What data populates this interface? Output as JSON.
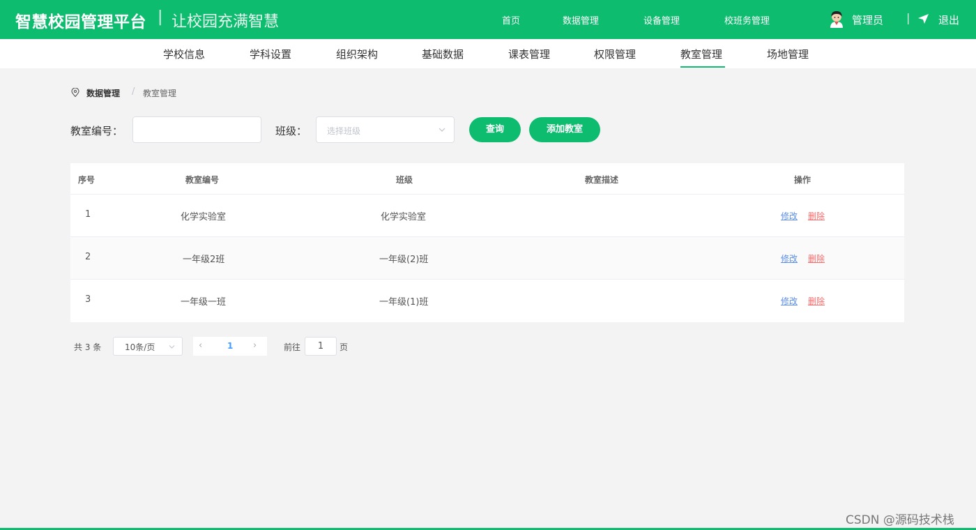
{
  "header": {
    "brand": "智慧校园管理平台",
    "separator": "|",
    "slogan": "让校园充满智慧",
    "nav": [
      "首页",
      "数据管理",
      "设备管理",
      "校班务管理"
    ],
    "user": "管理员",
    "divider": "|",
    "logout": "退出"
  },
  "subnav": {
    "items": [
      "学校信息",
      "学科设置",
      "组织架构",
      "基础数据",
      "课表管理",
      "权限管理",
      "教室管理",
      "场地管理"
    ],
    "active": "教室管理"
  },
  "breadcrumb": {
    "parent": "数据管理",
    "separator": "/",
    "current": "教室管理"
  },
  "filter": {
    "room_label": "教室编号：",
    "room_value": "",
    "class_label": "班级：",
    "class_placeholder": "选择班级",
    "query_button": "查询",
    "add_button": "添加教室"
  },
  "table": {
    "columns": [
      "序号",
      "教室编号",
      "班级",
      "教室描述",
      "操作"
    ],
    "rows": [
      {
        "index": "1",
        "room": "化学实验室",
        "class": "化学实验室",
        "desc": "",
        "edit": "修改",
        "delete": "删除"
      },
      {
        "index": "2",
        "room": "一年级2班",
        "class": "一年级(2)班",
        "desc": "",
        "edit": "修改",
        "delete": "删除"
      },
      {
        "index": "3",
        "room": "一年级一班",
        "class": "一年级(1)班",
        "desc": "",
        "edit": "修改",
        "delete": "删除"
      }
    ]
  },
  "pagination": {
    "total": "共 3 条",
    "page_size": "10条/页",
    "prev": "‹",
    "current_page": "1",
    "next": "›",
    "goto_prefix": "前往",
    "goto_value": "1",
    "goto_suffix": "页"
  },
  "watermark": "CSDN @源码技术栈",
  "colors": {
    "accent": "#0dbc6e",
    "link": "#5a8de8",
    "danger": "#f56c6c",
    "page_active": "#409eff"
  },
  "icons": [
    "avatar",
    "send-icon",
    "location-pin-icon",
    "chevron-down-icon",
    "chevron-left-icon",
    "chevron-right-icon"
  ]
}
